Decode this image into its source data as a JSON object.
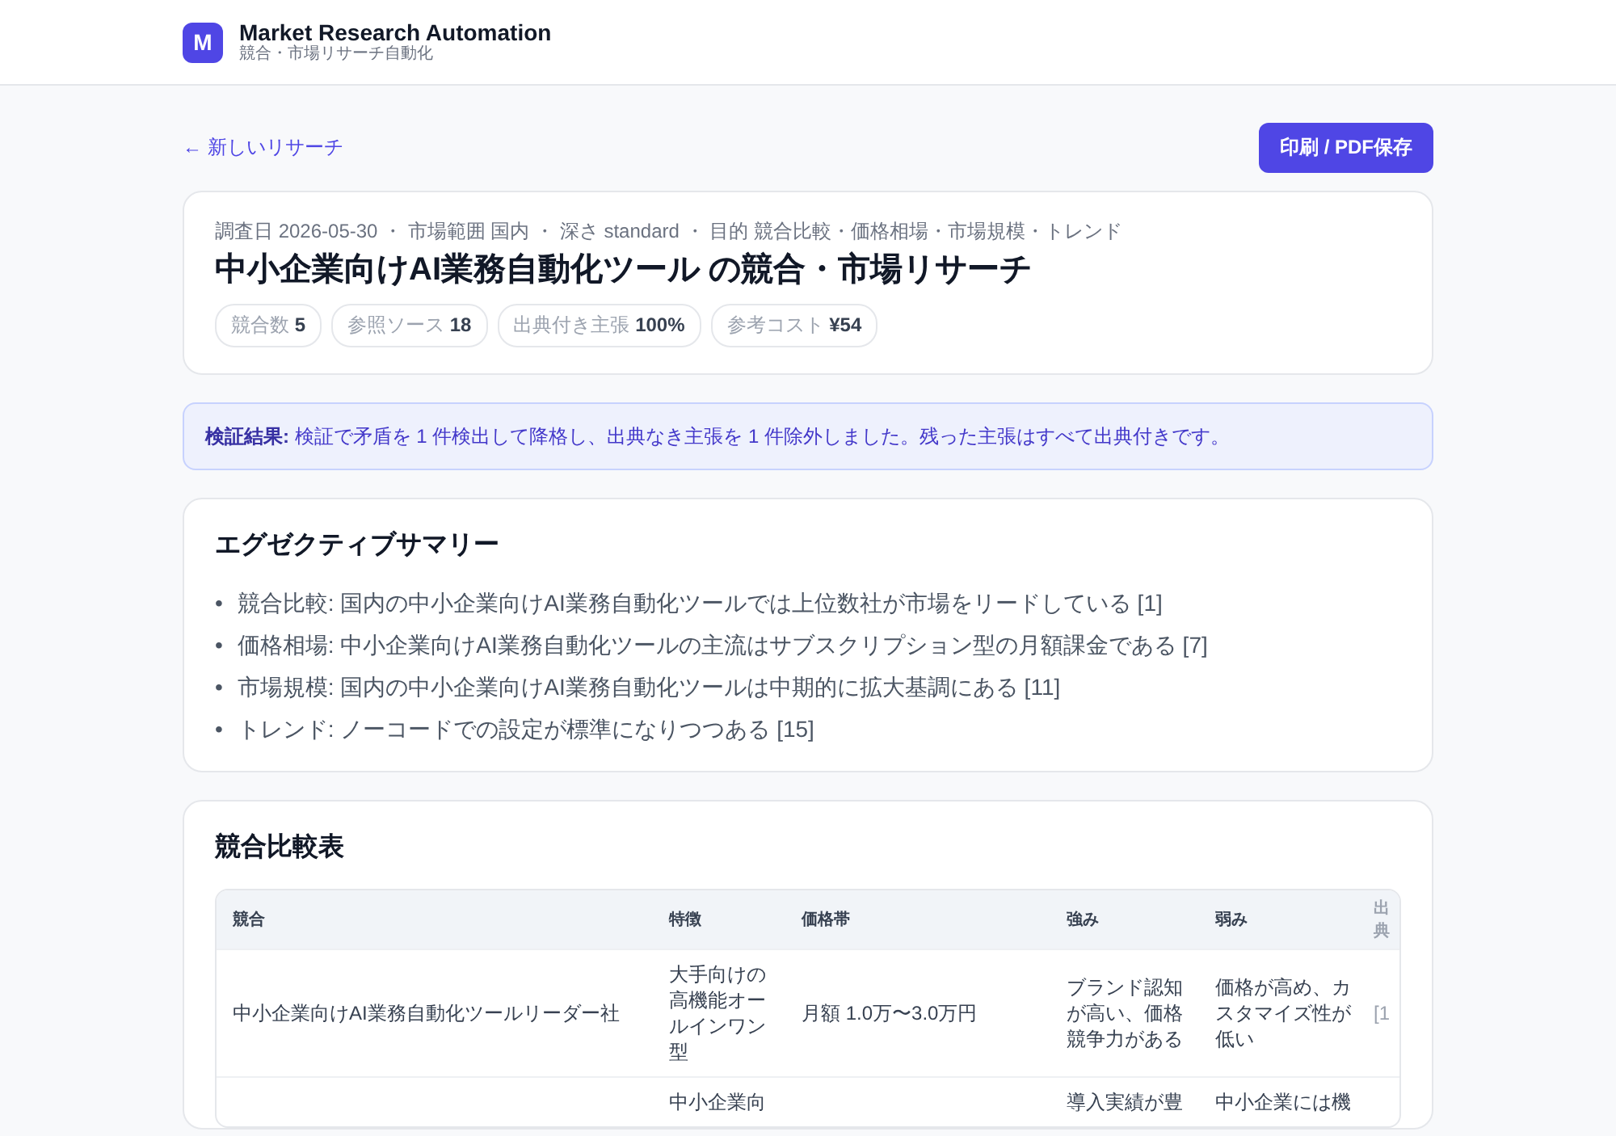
{
  "app": {
    "logo": "M",
    "title": "Market Research Automation",
    "subtitle": "競合・市場リサーチ自動化"
  },
  "back_link": "← 新しいリサーチ",
  "print_button": "印刷 / PDF保存",
  "report": {
    "meta": "調査日 2026-05-30 ・ 市場範囲 国内 ・ 深さ standard ・ 目的 競合比較・価格相場・市場規模・トレンド",
    "title": "中小企業向けAI業務自動化ツール の競合・市場リサーチ",
    "stats": [
      {
        "label": "競合数",
        "value": "5"
      },
      {
        "label": "参照ソース",
        "value": "18"
      },
      {
        "label": "出典付き主張",
        "value": "100%"
      },
      {
        "label": "参考コスト",
        "value": "¥54"
      }
    ]
  },
  "verification": "**検証結果:** 検証で矛盾を 1 件検出して降格し、出典なき主張を 1 件除外しました。残った主張はすべて出典付きです。",
  "summary": {
    "heading": "エグゼクティブサマリー",
    "bullet": "•",
    "items": [
      "競合比較: 国内の中小企業向けAI業務自動化ツールでは上位数社が市場をリードしている [1]",
      "価格相場: 中小企業向けAI業務自動化ツールの主流はサブスクリプション型の月額課金である [7]",
      "市場規模: 国内の中小企業向けAI業務自動化ツールは中期的に拡大基調にある [11]",
      "トレンド: ノーコードでの設定が標準になりつつある [15]"
    ]
  },
  "comparison": {
    "heading": "競合比較表",
    "columns": [
      "競合",
      "特徴",
      "価格帯",
      "強み",
      "弱み",
      "出典"
    ],
    "rows": [
      [
        "中小企業向けAI業務自動化ツールリーダー社",
        "大手向けの高機能オールインワン型",
        "月額 1.0万〜3.0万円",
        "ブランド認知が高い、価格競争力がある",
        "価格が高め、カスタマイズ性が低い",
        "[1"
      ],
      [
        "",
        "中小企業向",
        "",
        "導入実績が豊",
        "中小企業には機",
        ""
      ]
    ]
  }
}
